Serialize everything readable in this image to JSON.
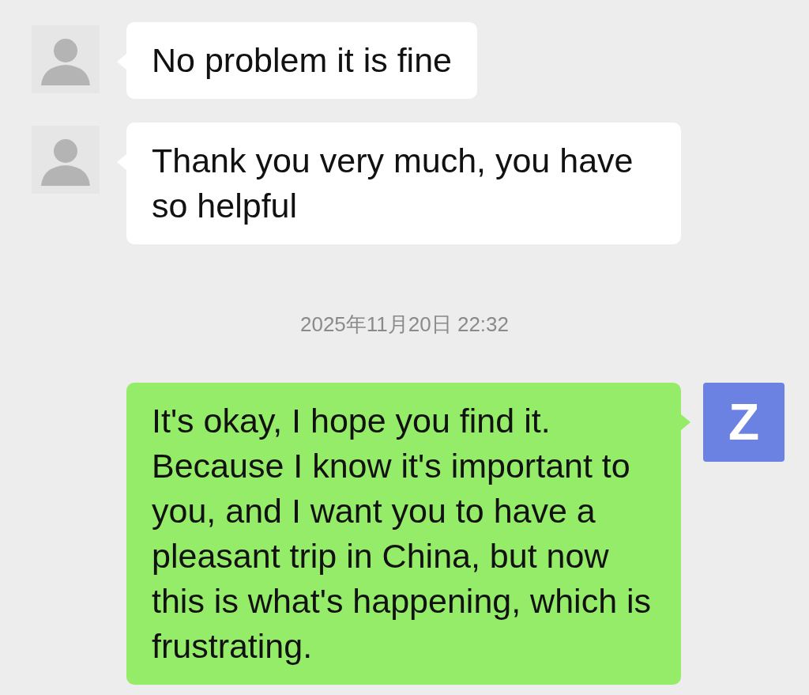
{
  "messages": [
    {
      "kind": "received",
      "text": "No problem it is fine"
    },
    {
      "kind": "received",
      "text": "Thank you very much, you have so helpful"
    },
    {
      "kind": "timestamp",
      "text": "2025年11月20日 22:32"
    },
    {
      "kind": "sent",
      "text": "It's okay, I hope you find it. Because I know it's important to you, and I want you to have a pleasant trip in China, but now this is what's happening, which is frustrating.",
      "avatar": {
        "letter": "Z",
        "color": "#6b82e3"
      }
    }
  ]
}
